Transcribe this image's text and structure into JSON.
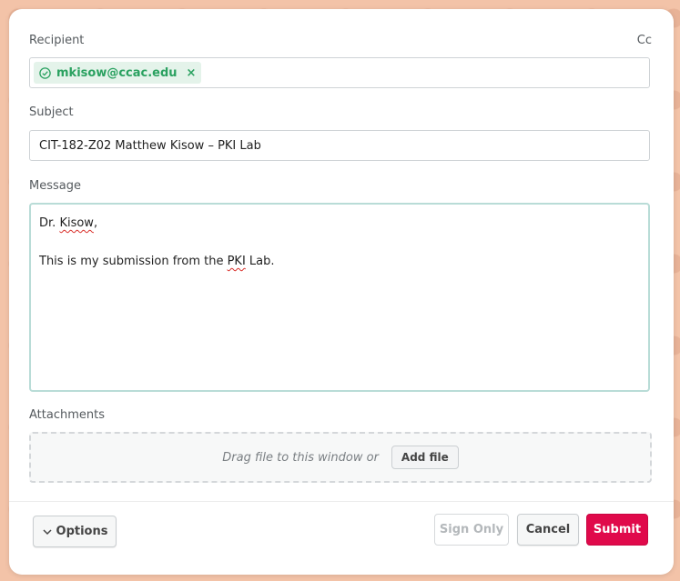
{
  "recipient": {
    "label": "Recipient",
    "cc_label": "Cc",
    "chip_email": "mkisow@ccac.edu",
    "chip_remove": "×"
  },
  "subject": {
    "label": "Subject",
    "value": "CIT-182-Z02 Matthew Kisow – PKI Lab"
  },
  "message": {
    "label": "Message",
    "greeting_pre": "Dr. ",
    "greeting_name": "Kisow",
    "greeting_post": ",",
    "body_pre": "This is my submission from the ",
    "body_acronym": "PKI",
    "body_post": " Lab."
  },
  "attachments": {
    "label": "Attachments",
    "drag_text": "Drag file to this window or",
    "add_file_label": "Add file"
  },
  "footer": {
    "options_label": "Options",
    "sign_only_label": "Sign Only",
    "cancel_label": "Cancel",
    "submit_label": "Submit"
  },
  "colors": {
    "accent_submit": "#e0094b",
    "chip_green": "#2aa160",
    "background": "#f3c3a8"
  },
  "icons": {
    "chip_icon": "check-circle-icon",
    "options_icon": "chevron-down-icon"
  }
}
